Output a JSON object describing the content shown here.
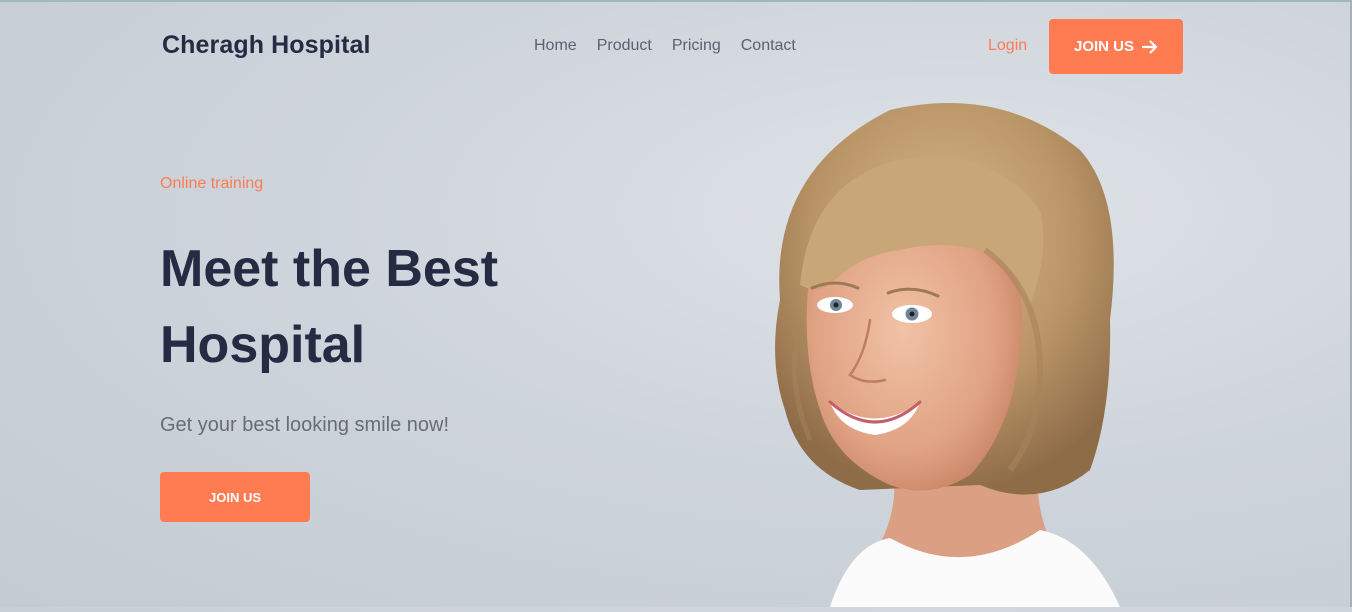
{
  "header": {
    "brand": "Cheragh Hospital",
    "nav": [
      "Home",
      "Product",
      "Pricing",
      "Contact"
    ],
    "login_label": "Login",
    "join_label": "JOIN US"
  },
  "hero": {
    "eyebrow": "Online training",
    "headline": "Meet the Best Hospital",
    "subline": "Get your best looking smile now!",
    "cta_label": "JOIN US"
  },
  "colors": {
    "accent": "#ff7b52",
    "heading": "#252b42",
    "nav_text": "#5b6170",
    "body_text": "#676d74",
    "background": "#cfd5dc"
  },
  "icons": {
    "join_arrow": "arrow-right-icon"
  }
}
